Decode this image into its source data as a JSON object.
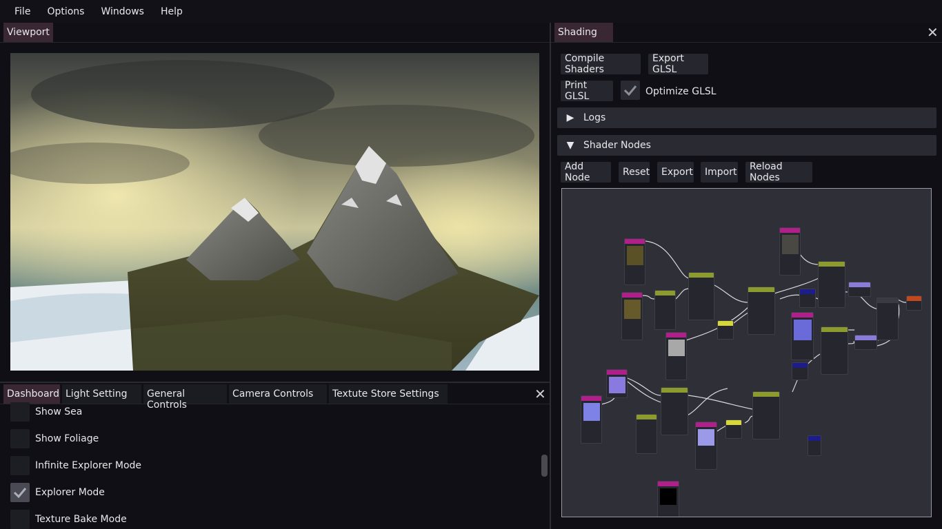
{
  "menu": [
    "File",
    "Options",
    "Windows",
    "Help"
  ],
  "viewport": {
    "tab": "Viewport"
  },
  "dashboard": {
    "tabs": [
      "Dashboard",
      "Light Setting",
      "General Controls",
      "Camera Controls",
      "Textute Store Settings"
    ],
    "options": [
      {
        "label": "Show Sea",
        "checked": false
      },
      {
        "label": "Show Foliage",
        "checked": false
      },
      {
        "label": "Infinite Explorer Mode",
        "checked": false
      },
      {
        "label": "Explorer Mode",
        "checked": true
      },
      {
        "label": "Texture Bake Mode",
        "checked": false
      }
    ]
  },
  "shading": {
    "tab": "Shading",
    "buttons": {
      "compile": "Compile Shaders",
      "export_glsl": "Export GLSL",
      "print_glsl": "Print GLSL",
      "optimize": "Optimize GLSL"
    },
    "optimize_checked": true,
    "logs_header": "Logs",
    "nodes_header": "Shader Nodes",
    "node_buttons": [
      "Add Node",
      "Reset",
      "Export",
      "Import",
      "Reload Nodes"
    ]
  },
  "colors": {
    "active_tab": "#3a2734",
    "node_magenta": "#b0208a",
    "node_olive": "#8c9a2e",
    "node_yellow": "#d6d83a",
    "node_purple": "#8a7bd8",
    "node_navy": "#1c1c8c",
    "node_orange": "#c4481e"
  }
}
